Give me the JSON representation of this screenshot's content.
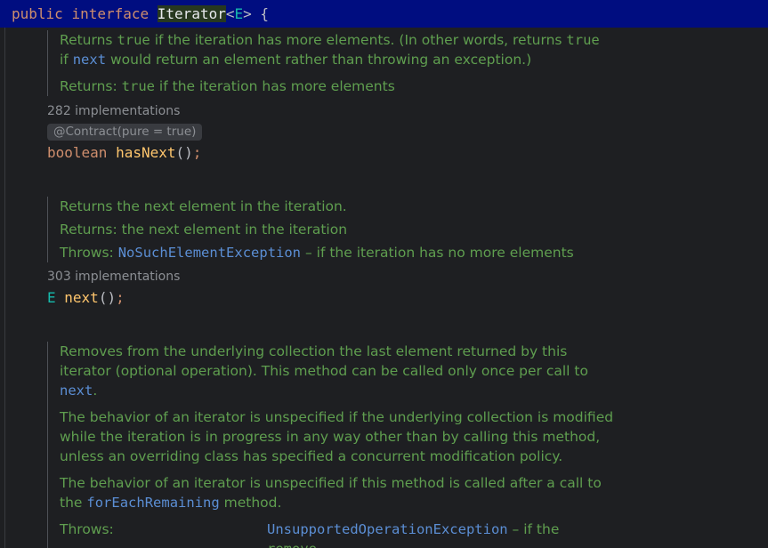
{
  "header": {
    "kw_public": "public",
    "kw_interface": "interface",
    "class_name": "Iterator",
    "lt": "<",
    "type_param": "E",
    "gt": ">",
    "brace": " {"
  },
  "has_next_doc": {
    "line1_a": "Returns ",
    "line1_true": "true",
    "line1_b": " if the iteration has more elements. (In other words, returns ",
    "line1_true2": "true",
    "line2_if": "if ",
    "line2_next": "next",
    "line2_b": " would return an element rather than throwing an exception.)",
    "returns_label": "Returns: ",
    "returns_true": "true",
    "returns_rest": " if the iteration has more elements"
  },
  "has_next_impl": "282 implementations",
  "has_next_annotation": "@Contract(pure = true)",
  "has_next_decl": {
    "type": "boolean",
    "name": "hasNext",
    "parens": "()",
    "semi": ";"
  },
  "next_doc": {
    "line1": "Returns the next element in the iteration.",
    "returns": "Returns: the next element in the iteration",
    "throws_label": "Throws: ",
    "throws_exc": "NoSuchElementException",
    "throws_rest": " – if the iteration has no more elements"
  },
  "next_impl": "303 implementations",
  "next_decl": {
    "type": "E",
    "name": "next",
    "parens": "()",
    "semi": ";"
  },
  "remove_doc": {
    "p1_line1": "Removes from the underlying collection the last element returned by this",
    "p1_line2": "iterator (optional operation). This method can be called only once per call to",
    "p1_next": "next",
    "p1_dot": ".",
    "p2_line1": "The behavior of an iterator is unspecified if the underlying collection is modified",
    "p2_line2": "while the iteration is in progress in any way other than by calling this method,",
    "p2_line3": "unless an overriding class has specified a concurrent modification policy.",
    "p3_line1": "The behavior of an iterator is unspecified if this method is called after a call to",
    "p3_the": "the ",
    "p3_link": "forEachRemaining",
    "p3_rest": " method.",
    "throws_label": "Throws:",
    "throws_exc": "UnsupportedOperationException",
    "throws_rest": " – if the",
    "throws_partial": "remove"
  },
  "colors": {
    "background": "#1e1f22",
    "header_bg": "#000d80",
    "doc_green": "#5f9e4f",
    "link_blue": "#5b8ed4",
    "keyword": "#cf8e6d",
    "method_decl": "#ffc66d",
    "type_param": "#16baac"
  }
}
